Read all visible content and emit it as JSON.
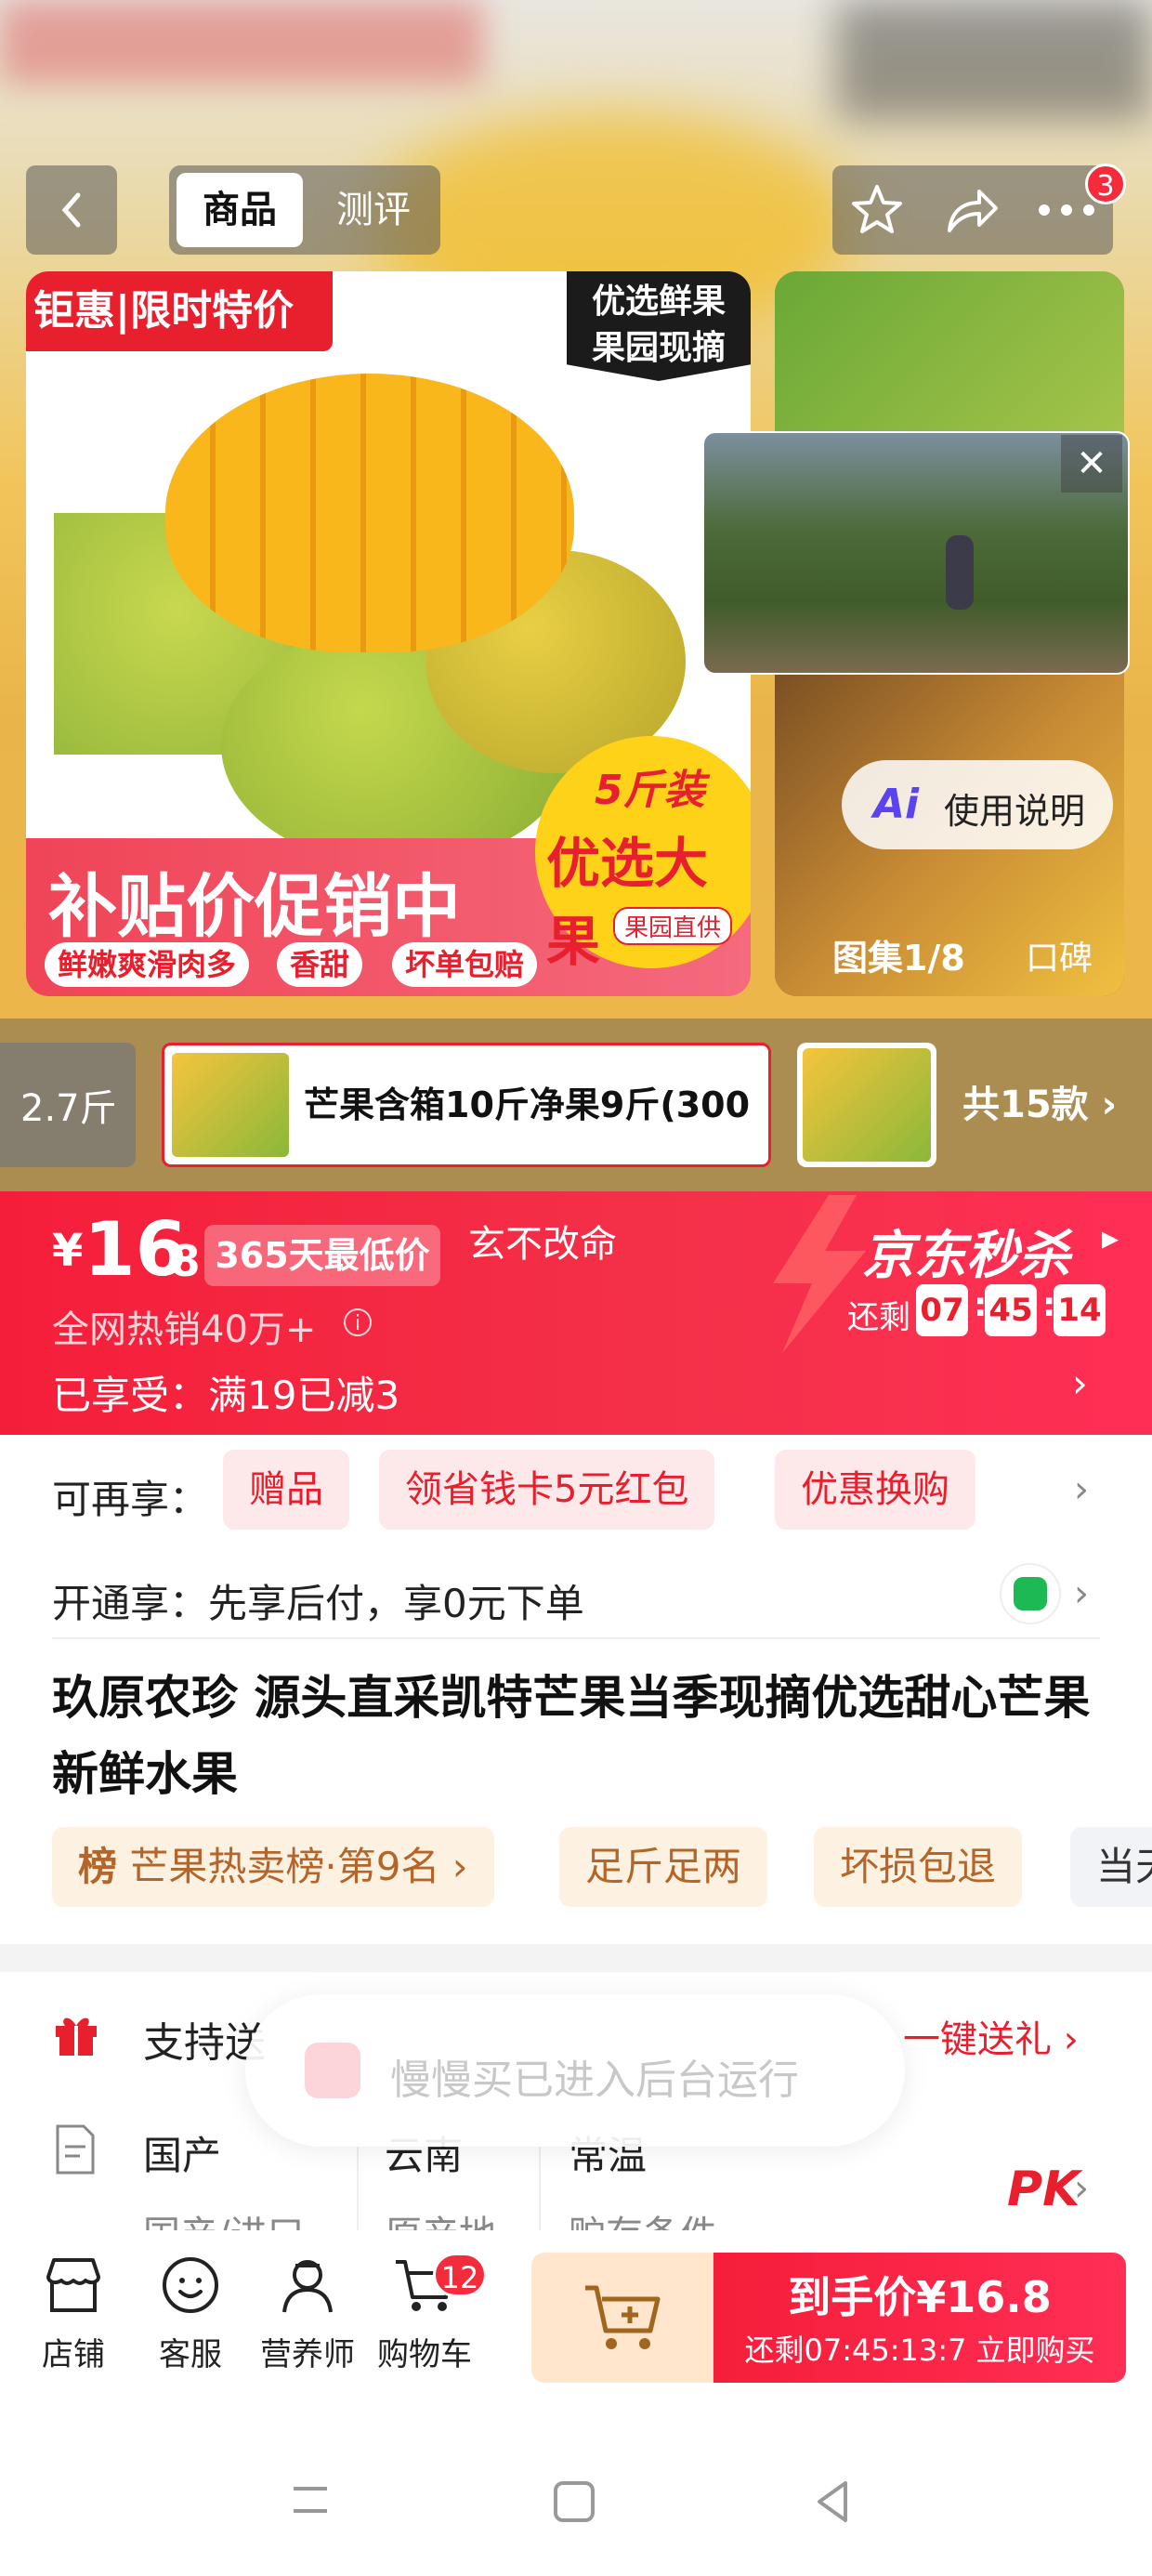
{
  "header": {
    "tabs": [
      "商品",
      "测评"
    ],
    "notification_count": "3"
  },
  "hero": {
    "main_tag": "钜惠|限时特价",
    "quality_tag_line1": "优选鲜果",
    "quality_tag_line2": "果园现摘",
    "promo_text": "补贴价促销中",
    "chips": [
      "鲜嫩爽滑肉多",
      "香甜",
      "坏单包赔"
    ],
    "circle_line1": "5斤装",
    "circle_line2": "优选大果",
    "circle_line3": "果园直供",
    "ai_label": "使用说明",
    "gallery_counter": "图集1/8",
    "gallery_extra": "口碑"
  },
  "variants": {
    "prev_label": "2.7斤",
    "selected_label": "芒果含箱10斤净果9斤(300",
    "total_label": "共15款"
  },
  "price": {
    "currency": "¥",
    "integer": "16",
    "decimal": ".8",
    "low_badge": "365天最低价",
    "motto": "玄不改命",
    "hot_sell": "全网热销40万+",
    "enjoyed": "已享受：满19已减3",
    "seckill_title": "京东秒杀",
    "remain_label": "还剩",
    "countdown": [
      "07",
      "45",
      "14"
    ]
  },
  "benefits": {
    "more_label": "可再享：",
    "chips": [
      "赠品",
      "领省钱卡5元红包",
      "优惠换购"
    ],
    "open_label": "开通享：先享后付，享0元下单"
  },
  "product": {
    "title": "玖原农珍 源头直采凯特芒果当季现摘优选甜心芒果 新鲜水果",
    "rank_prefix": "榜",
    "rank_label": "芒果热卖榜·第9名",
    "tags": [
      "足斤足两",
      "坏损包退",
      "当天"
    ]
  },
  "service": {
    "support_label": "支持送",
    "send_gift": "一键送礼",
    "toast": "慢慢买已进入后台运行",
    "attrs": [
      {
        "value": "国产",
        "key": "国产/进口"
      },
      {
        "value": "云南",
        "key": "原产地"
      },
      {
        "value": "常温",
        "key": "贮存条件"
      }
    ],
    "pk_label": "PK"
  },
  "bottom_bar": {
    "items": [
      "店铺",
      "客服",
      "营养师",
      "购物车"
    ],
    "cart_count": "12",
    "buy_price": "到手价¥16.8",
    "buy_sub": "还剩07:45:13:7  立即购买"
  },
  "colors": {
    "brand_red": "#f51e3a",
    "badge_red": "#f42b3a",
    "orange_bg": "#ffe6cc"
  }
}
